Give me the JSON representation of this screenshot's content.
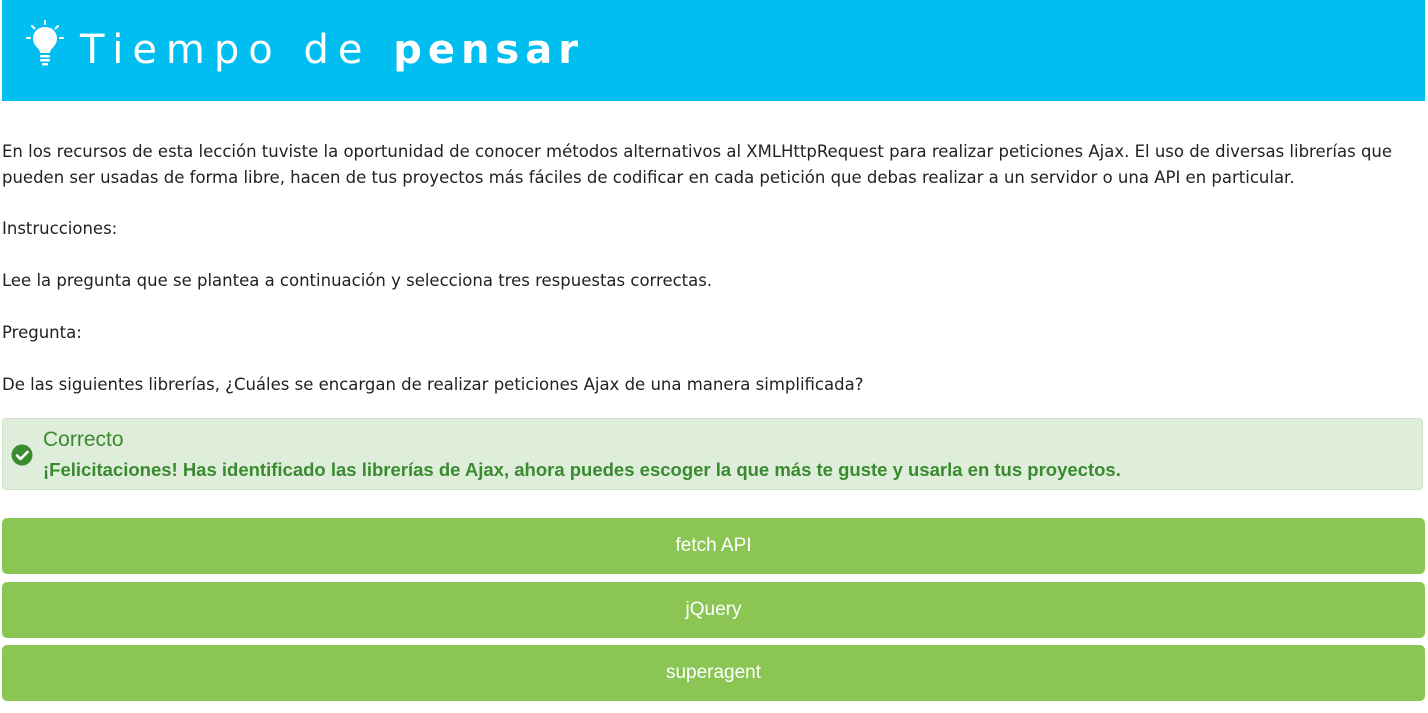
{
  "header": {
    "title_light": "Tiempo de",
    "title_bold": "pensar",
    "icon": "lightbulb-icon",
    "background_color": "#00bff0"
  },
  "content": {
    "intro_line1": "En los recursos de esta lección tuviste la oportunidad de conocer métodos alternativos al XMLHttpRequest para realizar peticiones Ajax. El uso de diversas librerías que",
    "intro_line2": "pueden ser usadas de forma libre, hacen de tus proyectos más fáciles de codificar en cada petición que debas realizar a un servidor o una API en particular.",
    "instructions_label": "Instrucciones:",
    "instructions_text": "Lee la pregunta que se plantea a continuación y selecciona tres respuestas correctas.",
    "question_label": "Pregunta:",
    "question_text": "De las siguientes librerías, ¿Cuáles se encargan de realizar peticiones Ajax de una manera simplificada?"
  },
  "feedback": {
    "icon": "check-circle-icon",
    "title": "Correcto",
    "message": "¡Felicitaciones! Has identificado las librerías de Ajax, ahora puedes escoger la que más te guste y usarla en tus proyectos.",
    "color": "#3a8a30",
    "background_color": "#dfeeda"
  },
  "options": [
    {
      "label": "fetch API"
    },
    {
      "label": "jQuery"
    },
    {
      "label": "superagent"
    }
  ],
  "option_color": "#8bc655"
}
